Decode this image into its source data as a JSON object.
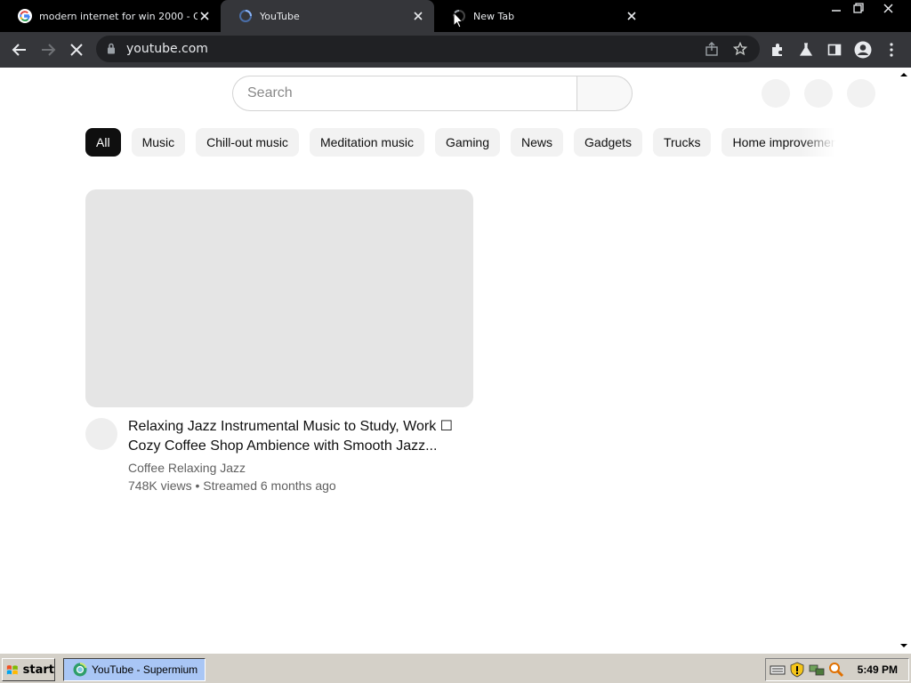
{
  "browser": {
    "tabs": [
      {
        "title": "modern internet for win 2000 - Goo",
        "favicon": "google-g-icon",
        "active": false
      },
      {
        "title": "YouTube",
        "favicon": "loading-spinner-icon",
        "active": true
      },
      {
        "title": "New Tab",
        "favicon": "loading-spinner-icon",
        "active": false
      }
    ],
    "address": "youtube.com",
    "colors": {
      "tabstrip": "#000000",
      "toolbar": "#35363a",
      "omnibox": "#202124"
    }
  },
  "youtube": {
    "search_placeholder": "Search",
    "chips": [
      "All",
      "Music",
      "Chill-out music",
      "Meditation music",
      "Gaming",
      "News",
      "Gadgets",
      "Trucks",
      "Home improvemen"
    ],
    "active_chip": "All",
    "video": {
      "title": "Relaxing Jazz Instrumental Music to Study, Work ☐ Cozy Coffee Shop Ambience with Smooth Jazz...",
      "channel": "Coffee Relaxing Jazz",
      "views": "748K views",
      "separator": "•",
      "age": "Streamed 6 months ago"
    }
  },
  "taskbar": {
    "start_label": "start",
    "task_label": "YouTube - Supermium",
    "clock": "5:49 PM"
  }
}
